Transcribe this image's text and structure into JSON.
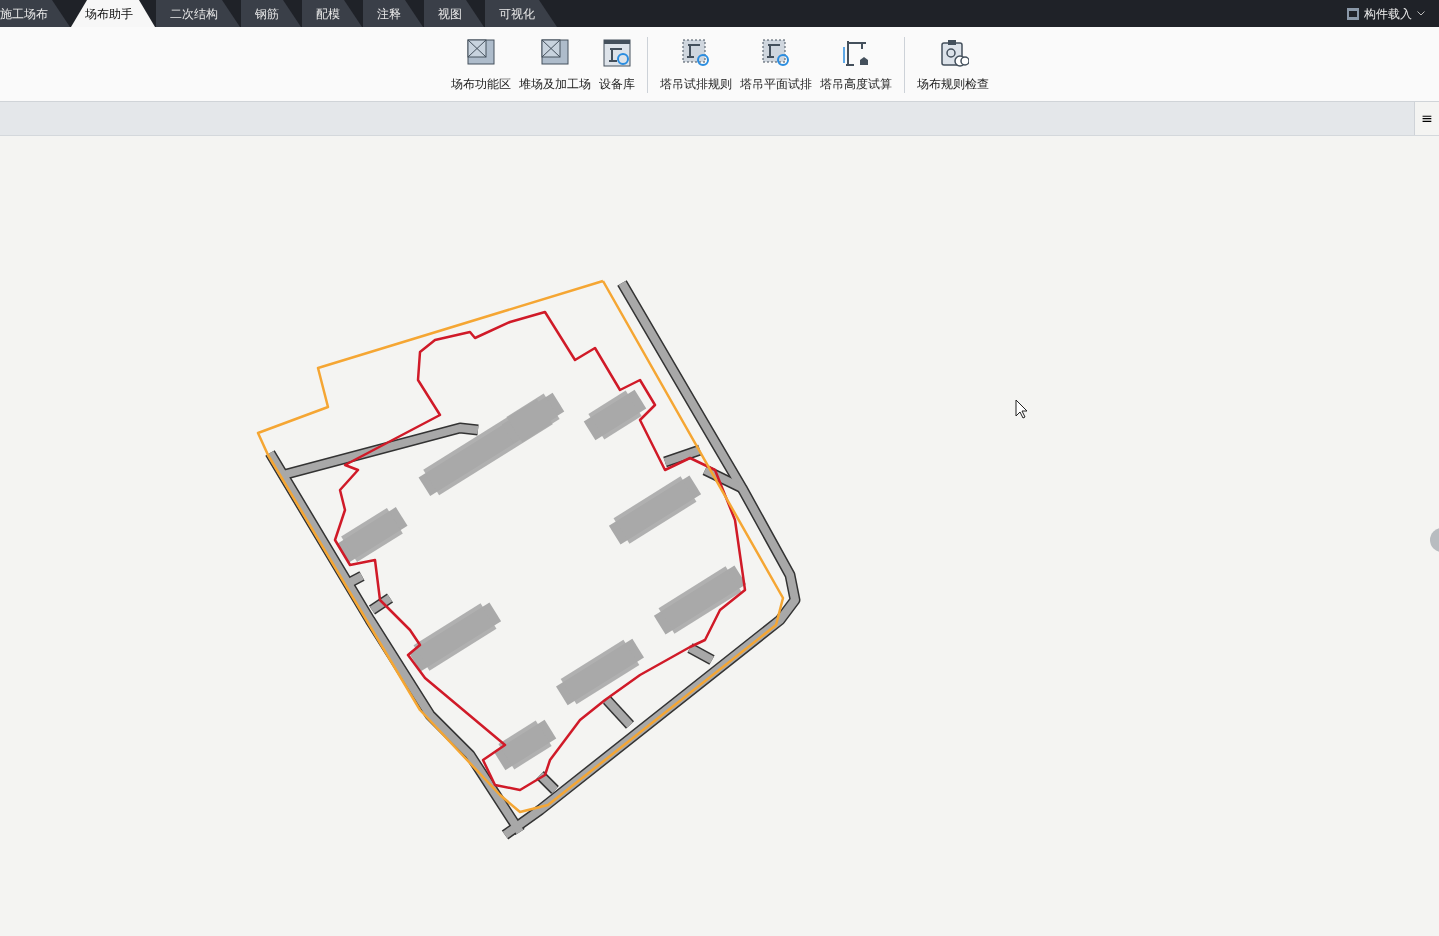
{
  "tabs": [
    {
      "label": "施工场布",
      "selected": false
    },
    {
      "label": "场布助手",
      "selected": true
    },
    {
      "label": "二次结构",
      "selected": false
    },
    {
      "label": "钢筋",
      "selected": false
    },
    {
      "label": "配模",
      "selected": false
    },
    {
      "label": "注释",
      "selected": false
    },
    {
      "label": "视图",
      "selected": false
    },
    {
      "label": "可视化",
      "selected": false
    }
  ],
  "load_button": {
    "label": "构件载入"
  },
  "toolbar_groups": [
    [
      {
        "label": "场布功能区"
      },
      {
        "label": "堆场及加工场"
      },
      {
        "label": "设备库"
      }
    ],
    [
      {
        "label": "塔吊试排规则"
      },
      {
        "label": "塔吊平面试排"
      },
      {
        "label": "塔吊高度试算"
      }
    ],
    [
      {
        "label": "场布规则检查"
      }
    ]
  ],
  "panel_menu": {
    "label": "≡"
  }
}
